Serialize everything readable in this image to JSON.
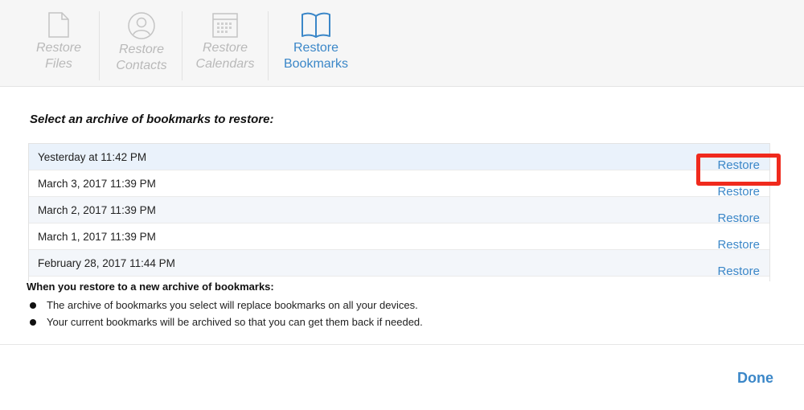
{
  "toolbar": {
    "tabs": [
      {
        "line1": "Restore",
        "line2": "Files",
        "icon": "file-icon"
      },
      {
        "line1": "Restore",
        "line2": "Contacts",
        "icon": "contact-icon"
      },
      {
        "line1": "Restore",
        "line2": "Calendars",
        "icon": "calendar-icon"
      },
      {
        "line1": "Restore",
        "line2": "Bookmarks",
        "icon": "book-icon"
      }
    ],
    "active_tab": "Restore Bookmarks"
  },
  "heading": "Select an archive of bookmarks to restore:",
  "archives": [
    {
      "date": "Yesterday at 11:42 PM",
      "action": "Restore"
    },
    {
      "date": "March 3, 2017 11:39 PM",
      "action": "Restore"
    },
    {
      "date": "March 2, 2017 11:39 PM",
      "action": "Restore"
    },
    {
      "date": "March 1, 2017 11:39 PM",
      "action": "Restore"
    },
    {
      "date": "February 28, 2017 11:44 PM",
      "action": "Restore"
    }
  ],
  "info": {
    "title": "When you restore to a new archive of bookmarks:",
    "bullets": [
      "The archive of bookmarks you select will replace bookmarks on all your devices.",
      "Your current bookmarks will be archived so that you can get them back if needed."
    ]
  },
  "done_label": "Done",
  "colors": {
    "accent": "#3b87c8",
    "highlight": "#f02a1d",
    "inactive": "#b9b9b9"
  }
}
